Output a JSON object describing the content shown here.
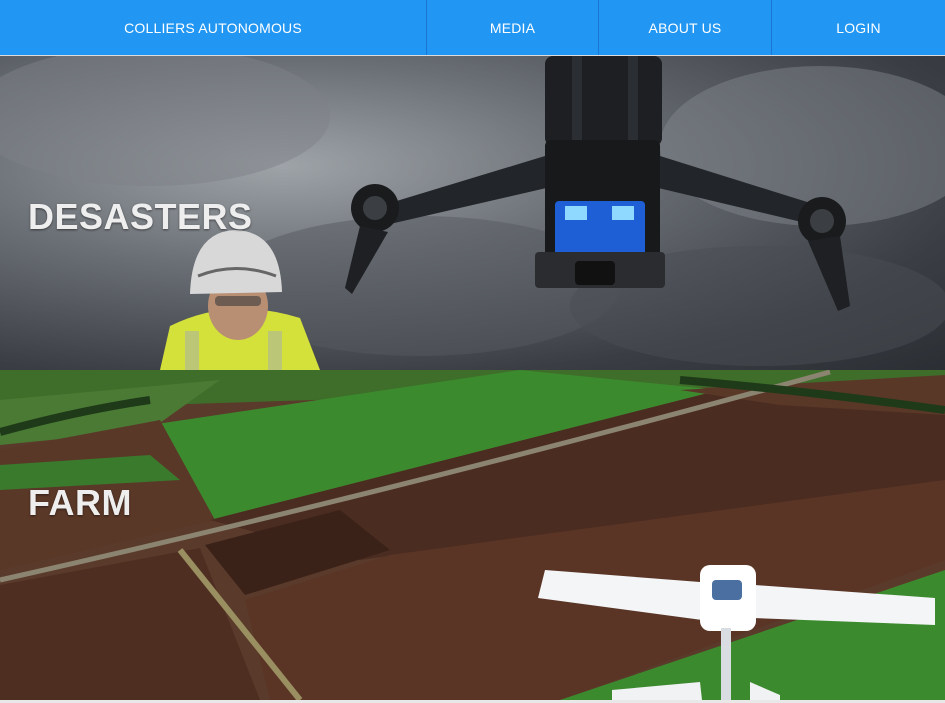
{
  "nav": {
    "brand": "COLLIERS AUTONOMOUS",
    "media": "MEDIA",
    "about": "ABOUT US",
    "login": "LOGIN"
  },
  "panels": {
    "disaster": {
      "title": "DESASTERS"
    },
    "farm": {
      "title": "FARM"
    }
  },
  "colors": {
    "nav_background": "#2196f3",
    "title_text": "#eeeeee"
  }
}
